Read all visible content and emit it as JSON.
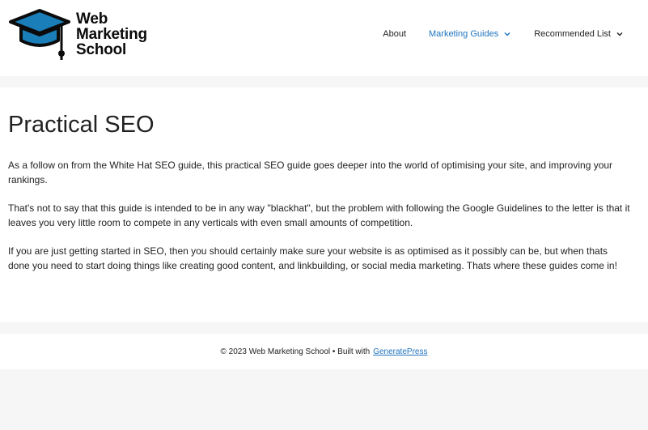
{
  "brand": {
    "line1": "Web",
    "line2": "Marketing",
    "line3": "School",
    "accent_color": "#1a7fb8"
  },
  "nav": {
    "items": [
      {
        "label": "About",
        "has_dropdown": false,
        "active": false
      },
      {
        "label": "Marketing Guides",
        "has_dropdown": true,
        "active": true
      },
      {
        "label": "Recommended List",
        "has_dropdown": true,
        "active": false
      }
    ],
    "active_color": "#1e73be"
  },
  "article": {
    "title": "Practical SEO",
    "paragraphs": [
      "As a follow on from the White Hat SEO guide, this practical SEO guide goes deeper into the world of optimising your site, and improving your rankings.",
      "That's not to say that this guide is intended to be in any way \"blackhat\", but the problem with following the Google Guidelines to the letter is that it leaves you very little room to compete in any verticals with even small amounts of competition.",
      "If you are just getting started in SEO, then you should certainly make sure your website is as optimised as it possibly can be, but when thats done you need to start doing things like creating good content, and linkbuilding, or social media marketing.  Thats where these guides come in!"
    ]
  },
  "footer": {
    "text": "© 2023 Web Marketing School • Built with",
    "link_label": "GeneratePress"
  }
}
